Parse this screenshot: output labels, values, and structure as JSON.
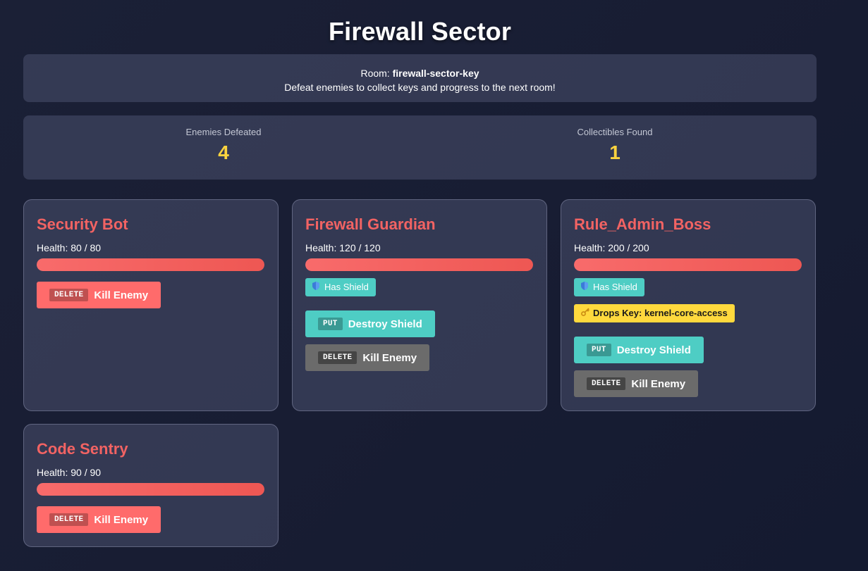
{
  "title": "Firewall Sector",
  "info": {
    "room_label": "Room: ",
    "room_name": "firewall-sector-key",
    "description": "Defeat enemies to collect keys and progress to the next room!"
  },
  "stats": {
    "enemies_label": "Enemies Defeated",
    "enemies_value": "4",
    "collectibles_label": "Collectibles Found",
    "collectibles_value": "1"
  },
  "enemies": [
    {
      "name": "Security Bot",
      "health_text": "Health: 80 / 80",
      "health": 80,
      "max_health": 80,
      "kill": {
        "method": "DELETE",
        "label": "Kill Enemy",
        "enabled": true
      }
    },
    {
      "name": "Firewall Guardian",
      "health_text": "Health: 120 / 120",
      "health": 120,
      "max_health": 120,
      "shield_badge": "Has Shield",
      "shield_icon": "shield-icon",
      "destroy_shield": {
        "method": "PUT",
        "label": "Destroy Shield"
      },
      "kill": {
        "method": "DELETE",
        "label": "Kill Enemy",
        "enabled": false
      }
    },
    {
      "name": "Rule_Admin_Boss",
      "health_text": "Health: 200 / 200",
      "health": 200,
      "max_health": 200,
      "shield_badge": "Has Shield",
      "shield_icon": "shield-icon",
      "drops_key": "Drops Key: kernel-core-access",
      "key_icon": "key-icon",
      "destroy_shield": {
        "method": "PUT",
        "label": "Destroy Shield"
      },
      "kill": {
        "method": "DELETE",
        "label": "Kill Enemy",
        "enabled": false
      }
    },
    {
      "name": "Code Sentry",
      "health_text": "Health: 90 / 90",
      "health": 90,
      "max_health": 90,
      "kill": {
        "method": "DELETE",
        "label": "Kill Enemy",
        "enabled": true
      }
    }
  ],
  "colors": {
    "enemy_name": "#f26363",
    "stat_value": "#fbd33f",
    "kill_button": "#ff6b6b",
    "kill_button_disabled": "#6b6b6b",
    "shield": "#4ecdc4",
    "key_badge": "#ffd93d"
  }
}
